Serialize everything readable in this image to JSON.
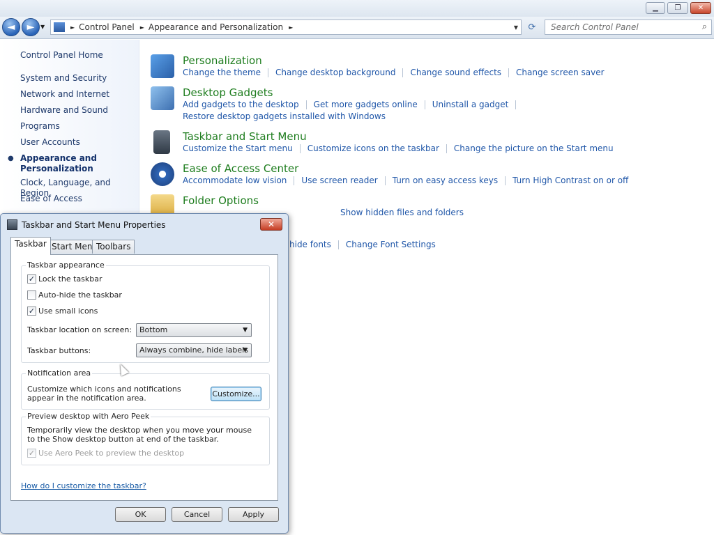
{
  "window": {
    "minimize_glyph": "▁",
    "maximize_glyph": "❐",
    "close_glyph": "✕"
  },
  "nav": {
    "back_glyph": "◄",
    "forward_glyph": "►",
    "breadcrumb": [
      "Control Panel",
      "Appearance and Personalization"
    ],
    "refresh_glyph": "⟳",
    "search_placeholder": "Search Control Panel",
    "search_glyph": "⌕"
  },
  "sidebar": {
    "items": [
      {
        "label": "Control Panel Home"
      },
      {
        "label": "System and Security"
      },
      {
        "label": "Network and Internet"
      },
      {
        "label": "Hardware and Sound"
      },
      {
        "label": "Programs"
      },
      {
        "label": "User Accounts"
      },
      {
        "label": "Appearance and\nPersonalization"
      },
      {
        "label": "Clock, Language, and Region"
      },
      {
        "label": "Ease of Access"
      }
    ]
  },
  "categories": [
    {
      "title": "Personalization",
      "icon": "personalization-icon",
      "links": [
        "Change the theme",
        "Change desktop background",
        "Change sound effects",
        "Change screen saver"
      ],
      "links2": []
    },
    {
      "title": "Desktop Gadgets",
      "icon": "gadgets-icon",
      "links": [
        "Add gadgets to the desktop",
        "Get more gadgets online",
        "Uninstall a gadget"
      ],
      "links2": [
        "Restore desktop gadgets installed with Windows"
      ]
    },
    {
      "title": "Taskbar and Start Menu",
      "icon": "taskbar-icon",
      "links": [
        "Customize the Start menu",
        "Customize icons on the taskbar",
        "Change the picture on the Start menu"
      ],
      "links2": []
    },
    {
      "title": "Ease of Access Center",
      "icon": "ease-of-access-icon",
      "links": [
        "Accommodate low vision",
        "Use screen reader",
        "Turn on easy access keys",
        "Turn High Contrast on or off"
      ],
      "links2": []
    },
    {
      "title": "Folder Options",
      "icon": "folder-icon",
      "links": [
        "Show hidden files and folders"
      ],
      "links2": []
    }
  ],
  "fonts_links": [
    "hide fonts",
    "Change Font Settings"
  ],
  "dialog": {
    "title": "Taskbar and Start Menu Properties",
    "tabs": [
      "Taskbar",
      "Start Menu",
      "Toolbars"
    ],
    "appearance_group": "Taskbar appearance",
    "lock_label": "Lock the taskbar",
    "lock_checked": true,
    "autohide_label": "Auto-hide the taskbar",
    "autohide_checked": false,
    "small_icons_label": "Use small icons",
    "small_icons_checked": true,
    "location_label": "Taskbar location on screen:",
    "location_value": "Bottom",
    "buttons_label": "Taskbar buttons:",
    "buttons_value": "Always combine, hide labels",
    "notification_group": "Notification area",
    "notification_desc": "Customize which icons and notifications appear in the notification area.",
    "customize_label": "Customize...",
    "aero_group": "Preview desktop with Aero Peek",
    "aero_desc": "Temporarily view the desktop when you move your mouse to the Show desktop button at end of the taskbar.",
    "aero_label": "Use Aero Peek to preview the desktop",
    "aero_checked": true,
    "help_link": "How do I customize the taskbar?",
    "ok_label": "OK",
    "cancel_label": "Cancel",
    "apply_label": "Apply",
    "check_glyph": "✓",
    "caret_glyph": "▼"
  }
}
